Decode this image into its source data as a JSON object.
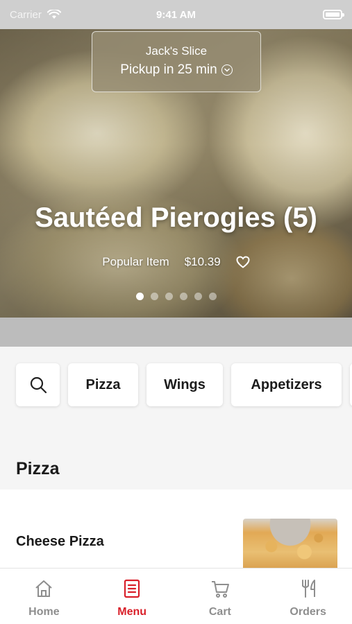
{
  "status_bar": {
    "carrier": "Carrier",
    "time": "9:41 AM"
  },
  "hero": {
    "restaurant_name": "Jack's Slice",
    "pickup_text": "Pickup in 25 min",
    "title": "Sautéed Pierogies (5)",
    "tag": "Popular Item",
    "price": "$10.39",
    "carousel_count": 6,
    "carousel_active_index": 0
  },
  "categories": {
    "items": [
      "Pizza",
      "Wings",
      "Appetizers"
    ]
  },
  "section": {
    "title": "Pizza"
  },
  "menu_items": [
    {
      "name": "Cheese Pizza"
    }
  ],
  "tab_bar": {
    "active": "Menu",
    "items": [
      {
        "label": "Home",
        "icon": "home-icon"
      },
      {
        "label": "Menu",
        "icon": "menu-icon"
      },
      {
        "label": "Cart",
        "icon": "cart-icon"
      },
      {
        "label": "Orders",
        "icon": "fork-knife-icon"
      }
    ]
  },
  "colors": {
    "accent": "#d9202a",
    "inactive": "#8e8e8e"
  }
}
